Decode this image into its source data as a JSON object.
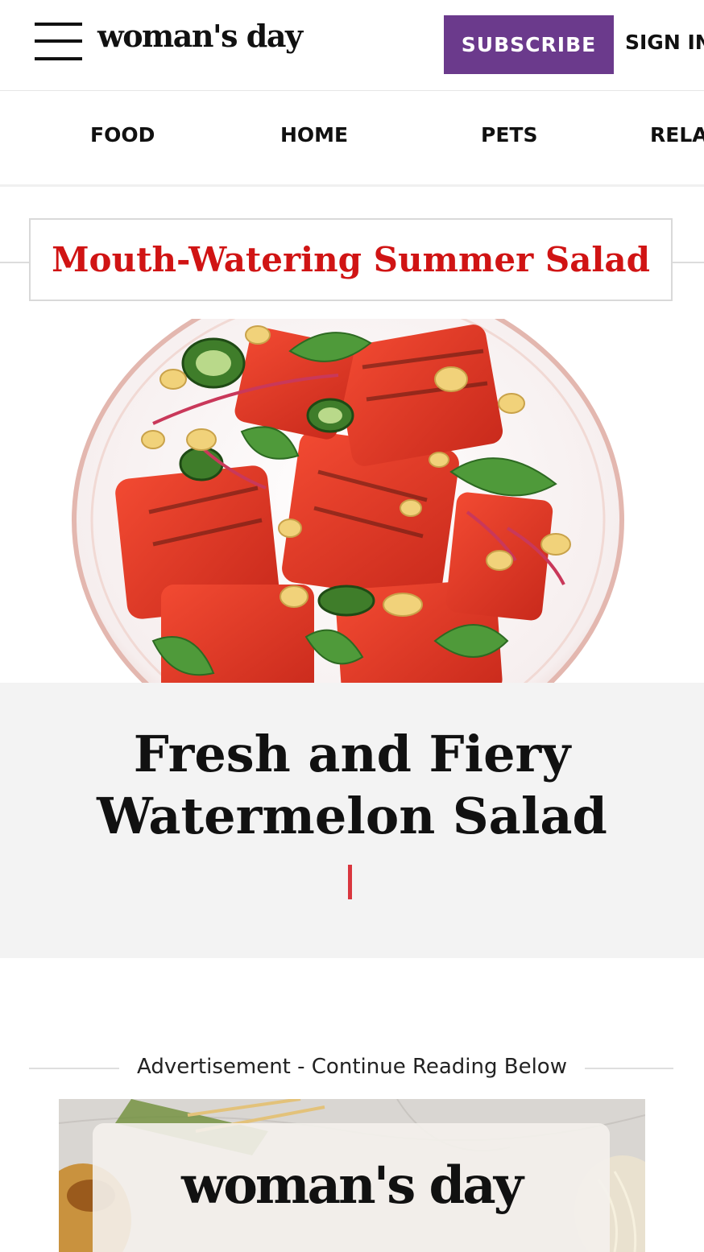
{
  "header": {
    "logo": "woman's day",
    "subscribe_label": "SUBSCRIBE",
    "signin_label": "SIGN IN"
  },
  "nav": {
    "items": [
      "FOOD",
      "HOME",
      "PETS",
      "RELAT"
    ]
  },
  "section": {
    "label": "Mouth-Watering Summer Salad"
  },
  "article": {
    "title_line1": "Fresh and Fiery",
    "title_line2": "Watermelon Salad"
  },
  "ad": {
    "label": "Advertisement - Continue Reading Below",
    "logo": "woman's day"
  },
  "colors": {
    "brand_purple": "#6b3a8c",
    "section_red": "#d01414",
    "divider_red": "#d9363e",
    "title_card_bg": "#f3f3f3"
  },
  "icons": [
    "menu-icon"
  ]
}
